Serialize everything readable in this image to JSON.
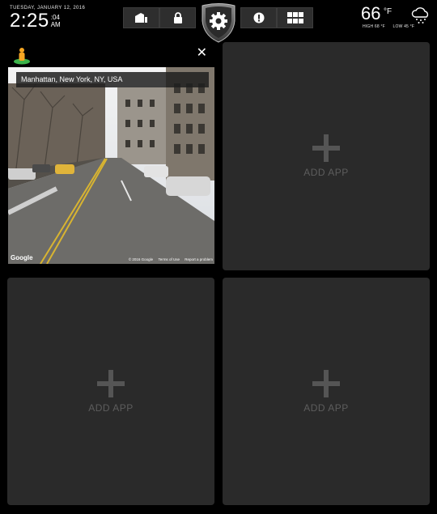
{
  "header": {
    "date": "TUESDAY, JANUARY 12, 2016",
    "time_hm": "2:25",
    "time_sec": ":04",
    "time_ampm": "AM",
    "nav_icons": [
      "garage-icon",
      "lock-icon",
      "gear-icon",
      "alert-icon",
      "grid-icon"
    ]
  },
  "weather": {
    "temp": "66",
    "unit": "°F",
    "high": "HIGH 68 °F",
    "low": "LOW 45 °F",
    "icon": "snow-cloud-icon"
  },
  "map_panel": {
    "address": "Manhattan, New York, NY, USA",
    "google_label": "Google",
    "copyright": "© 2016 Google",
    "terms_label": "Terms of Use",
    "report_label": "Report a problem",
    "close_label": "✕"
  },
  "panels": {
    "add_app_label": "ADD APP"
  },
  "colors": {
    "panel_bg": "#2a2a2a",
    "add_app_text": "#5d5d5d",
    "pegman_orange": "#f5a623",
    "pegman_green": "#3cb34a"
  }
}
